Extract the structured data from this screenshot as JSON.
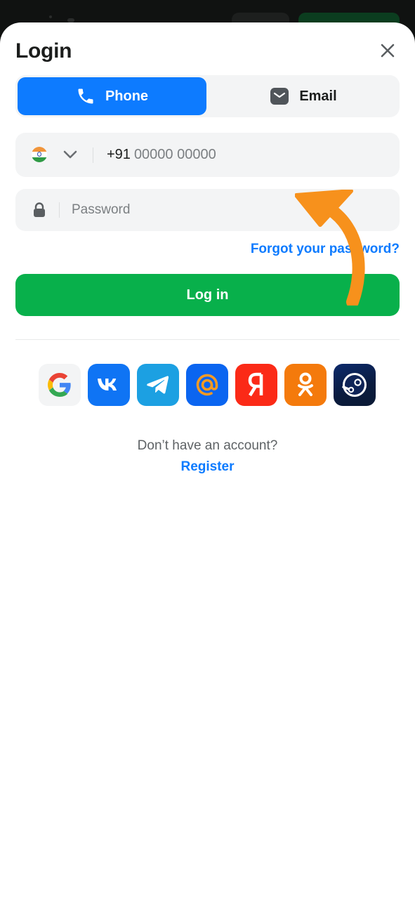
{
  "dialog": {
    "title": "Login",
    "close_icon": "close-icon"
  },
  "tabs": [
    {
      "label": "Phone",
      "icon": "phone-icon",
      "active": true
    },
    {
      "label": "Email",
      "icon": "envelope-icon",
      "active": false
    }
  ],
  "phone_field": {
    "country_flag": "india-flag-icon",
    "prefix": "+91",
    "placeholder": "00000 00000"
  },
  "password_field": {
    "placeholder": "Password",
    "icon": "lock-icon"
  },
  "forgot_link": "Forgot your password?",
  "login_button": "Log in",
  "social_providers": [
    "google-icon",
    "vk-icon",
    "telegram-icon",
    "mail-ru-icon",
    "yandex-icon",
    "odnoklassniki-icon",
    "steam-icon"
  ],
  "footer": {
    "prompt": "Don’t have an account?",
    "register_link": "Register"
  },
  "colors": {
    "accent": "#0d7bff",
    "login_green": "#08b04b",
    "arrow_orange": "#f7911c"
  }
}
